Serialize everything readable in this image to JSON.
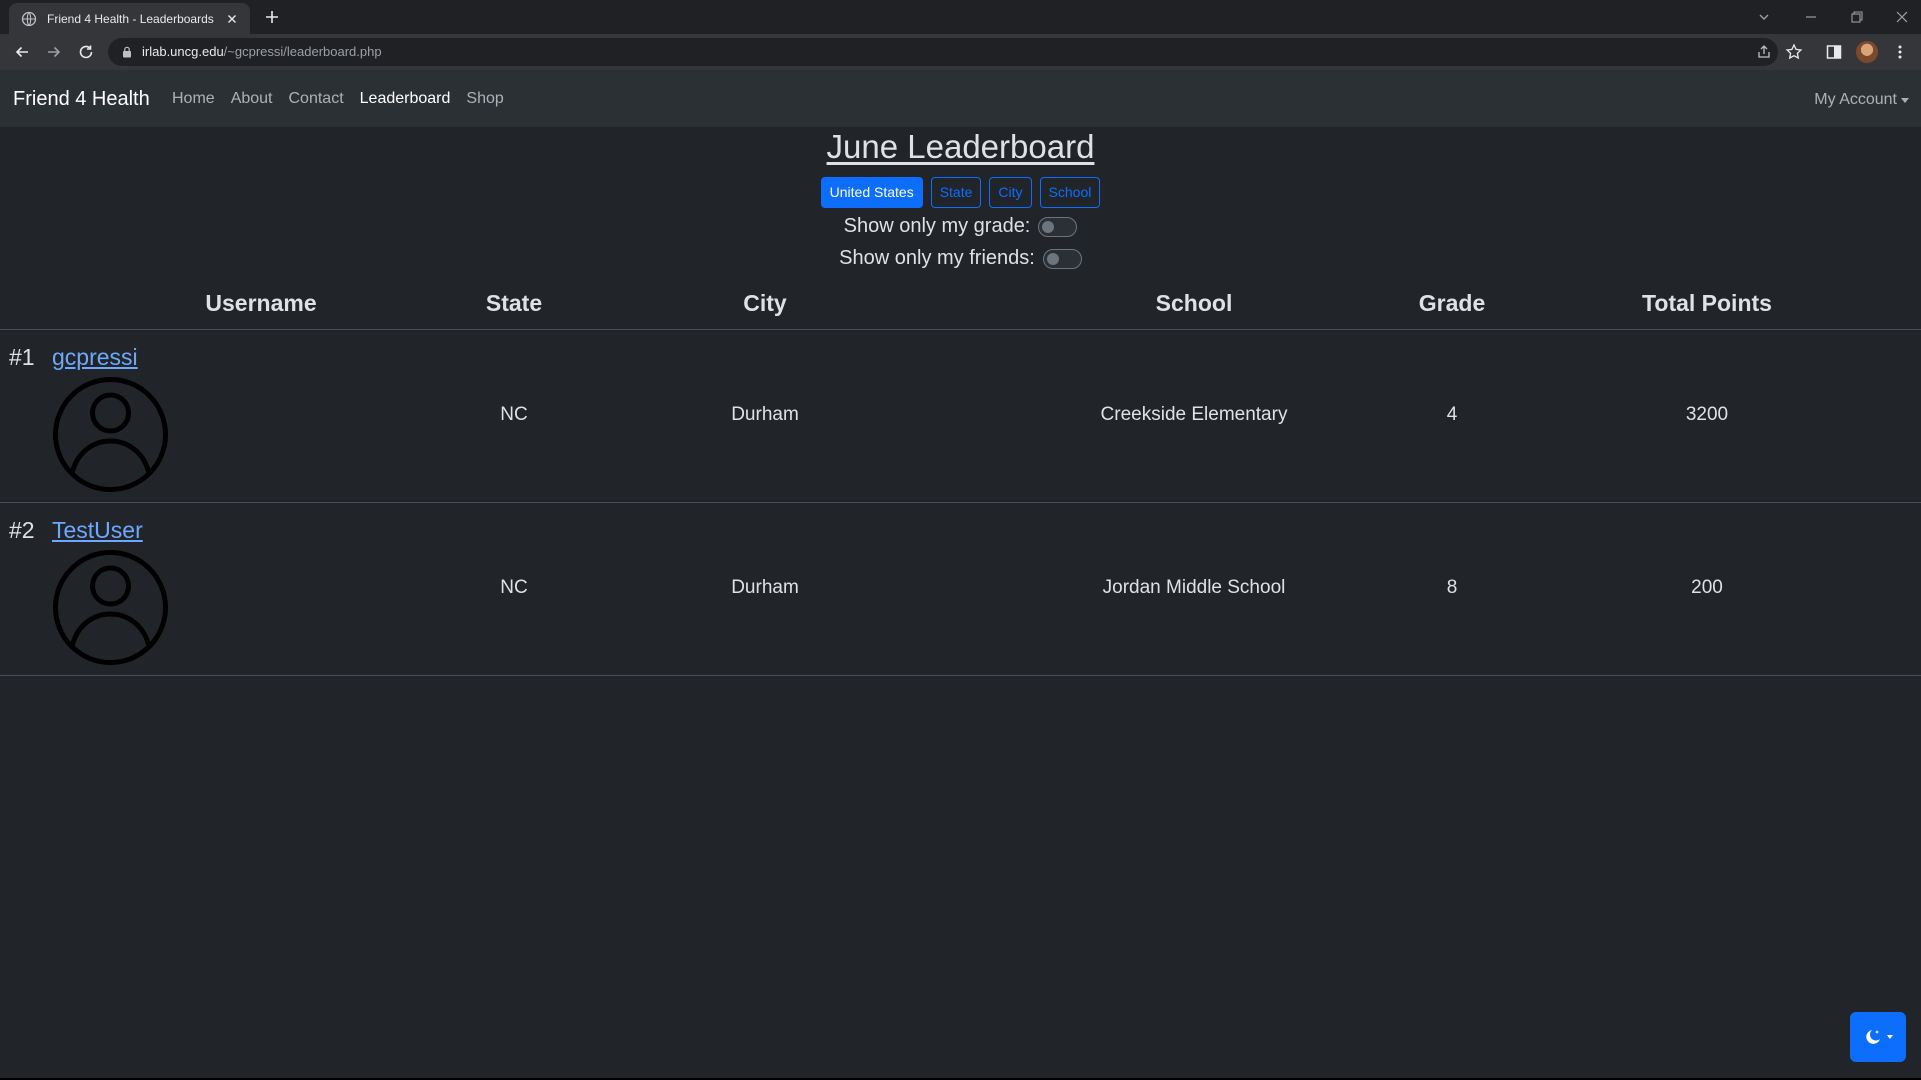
{
  "browser": {
    "tab_title": "Friend 4 Health - Leaderboards",
    "url_host": "irlab.uncg.edu",
    "url_path": "/~gcpressi/leaderboard.php"
  },
  "navbar": {
    "brand": "Friend 4 Health",
    "links": [
      "Home",
      "About",
      "Contact",
      "Leaderboard",
      "Shop"
    ],
    "active_link": "Leaderboard",
    "account": "My Account"
  },
  "leaderboard": {
    "title": "June Leaderboard",
    "filters": [
      "United States",
      "State",
      "City",
      "School"
    ],
    "active_filter": "United States",
    "toggle_grade_label": "Show only my grade:",
    "toggle_friends_label": "Show only my friends:",
    "toggle_grade_on": false,
    "toggle_friends_on": false,
    "headers": [
      "Username",
      "State",
      "City",
      "School",
      "Grade",
      "Total Points"
    ],
    "rows": [
      {
        "rank": "#1",
        "username": "gcpressi",
        "state": "NC",
        "city": "Durham",
        "school": "Creekside Elementary",
        "grade": "4",
        "points": "3200"
      },
      {
        "rank": "#2",
        "username": "TestUser",
        "state": "NC",
        "city": "Durham",
        "school": "Jordan Middle School",
        "grade": "8",
        "points": "200"
      }
    ]
  },
  "colors": {
    "background": "#212529",
    "navbar": "#2b3035",
    "primary": "#0d6efd",
    "link": "#6ea8fe"
  },
  "icons": {
    "theme_toggle": "moon-stars-icon",
    "avatar": "person-circle-icon"
  }
}
